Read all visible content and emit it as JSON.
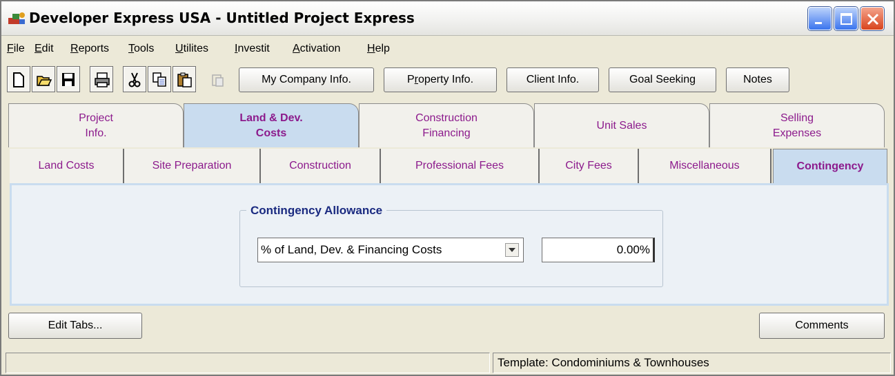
{
  "window": {
    "title": "Developer Express  USA - Untitled Project Express"
  },
  "menu": [
    {
      "pre": "",
      "u": "F",
      "post": "ile"
    },
    {
      "pre": "",
      "u": "E",
      "post": "dit"
    },
    {
      "pre": "",
      "u": "R",
      "post": "eports"
    },
    {
      "pre": "",
      "u": "T",
      "post": "ools"
    },
    {
      "pre": "",
      "u": "U",
      "post": "tilites"
    },
    {
      "pre": "",
      "u": "I",
      "post": "nvestit"
    },
    {
      "pre": "",
      "u": "A",
      "post": "ctivation"
    },
    {
      "pre": "",
      "u": "H",
      "post": "elp"
    }
  ],
  "toolbar": {
    "icons": [
      "new-icon",
      "open-icon",
      "save-icon",
      "print-icon",
      "cut-icon",
      "copy-icon",
      "paste-icon",
      "paste-disabled-icon"
    ],
    "my_company": "My Company Info.",
    "property_pre": "P",
    "property_u": "r",
    "property_post": "operty Info.",
    "client": "Client Info.",
    "goal": "Goal Seeking",
    "notes": "Notes"
  },
  "main_tabs": [
    {
      "line1": "Project",
      "line2": "Info."
    },
    {
      "line1": "Land & Dev.",
      "line2": "Costs"
    },
    {
      "line1": "Construction",
      "line2": "Financing"
    },
    {
      "line1": "Unit Sales",
      "line2": ""
    },
    {
      "line1": "Selling",
      "line2": "Expenses"
    }
  ],
  "sub_tabs": [
    "Land Costs",
    "Site Preparation",
    "Construction",
    "Professional Fees",
    "City Fees",
    "Miscellaneous",
    "Contingency"
  ],
  "contingency": {
    "group_title": "Contingency Allowance",
    "basis": "% of Land, Dev. & Financing Costs",
    "percent": "0.00%"
  },
  "buttons": {
    "edit_tabs": "Edit Tabs...",
    "comments": "Comments"
  },
  "status": {
    "left": "",
    "template": "Template: Condominiums & Townhouses"
  },
  "colors": {
    "tab_text": "#8c1a8c",
    "active_tab": "#c9dcef",
    "group_title": "#1a2a80"
  }
}
